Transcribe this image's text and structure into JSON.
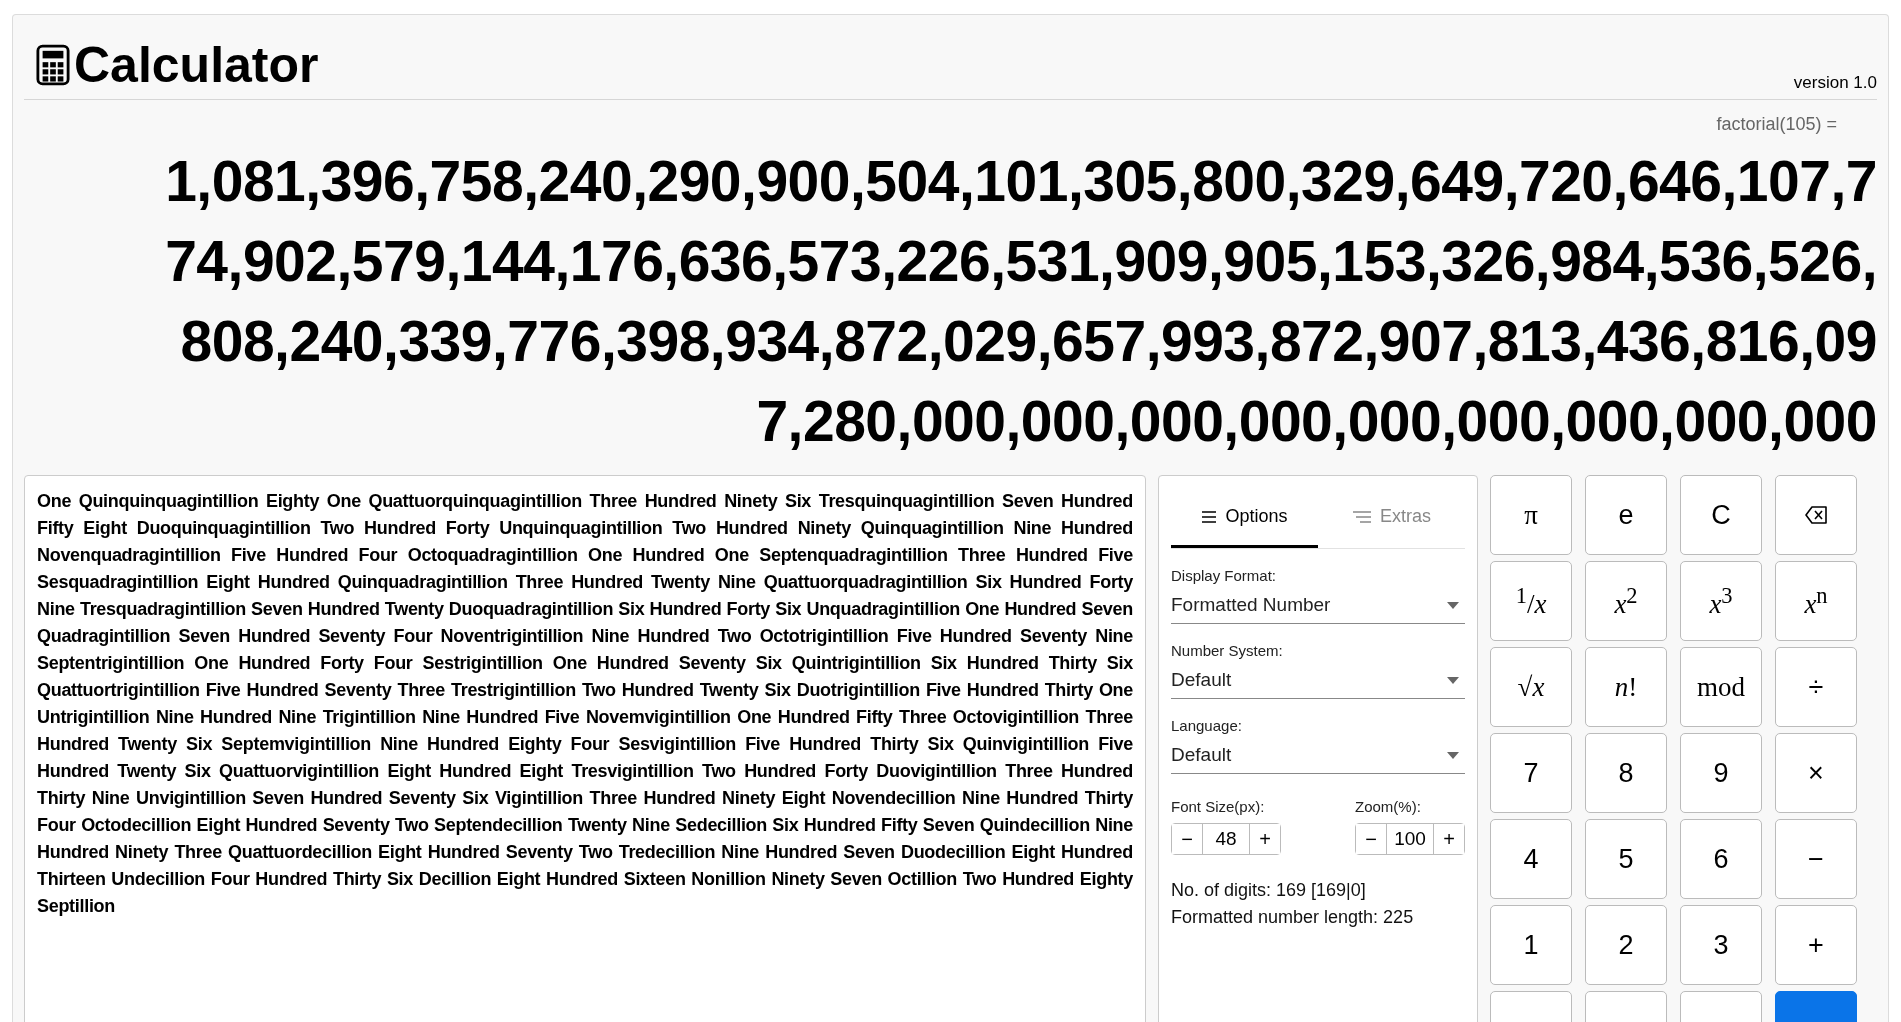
{
  "header": {
    "title": "Calculator",
    "version": "version 1.0"
  },
  "expression": "factorial(105) =",
  "result_lines": [
    "1,081,396,758,240,290,900,504,101,305,800,329,649,720,646,107,7",
    "74,902,579,144,176,636,573,226,531,909,905,153,326,984,536,526,",
    "808,240,339,776,398,934,872,029,657,993,872,907,813,436,816,09",
    "7,280,000,000,000,000,000,000,000,000,000"
  ],
  "words": "One Quinquinquagintillion Eighty One Quattuorquinquagintillion Three Hundred Ninety Six Tresquinquagintillion Seven Hundred Fifty Eight Duoquinquagintillion Two Hundred Forty Unquinquagintillion Two Hundred Ninety Quinquagintillion Nine Hundred Novenquadragintillion Five Hundred Four Octoquadragintillion One Hundred One Septenquadragintillion Three Hundred Five Sesquadragintillion Eight Hundred Quinquadragintillion Three Hundred Twenty Nine Quattuorquadragintillion Six Hundred Forty Nine Tresquadragintillion Seven Hundred Twenty Duoquadragintillion Six Hundred Forty Six Unquadragintillion One Hundred Seven Quadragintillion Seven Hundred Seventy Four Noventrigintillion Nine Hundred Two Octotrigintillion Five Hundred Seventy Nine Septentrigintillion One Hundred Forty Four Sestrigintillion One Hundred Seventy Six Quintrigintillion Six Hundred Thirty Six Quattuortrigintillion Five Hundred Seventy Three Trestrigintillion Two Hundred Twenty Six Duotrigintillion Five Hundred Thirty One Untrigintillion Nine Hundred Nine Trigintillion Nine Hundred Five Novemvigintillion One Hundred Fifty Three Octovigintillion Three Hundred Twenty Six Septemvigintillion Nine Hundred Eighty Four Sesvigintillion Five Hundred Thirty Six Quinvigintillion Five Hundred Twenty Six Quattuorvigintillion Eight Hundred Eight Tresvigintillion Two Hundred Forty Duovigintillion Three Hundred Thirty Nine Unvigintillion Seven Hundred Seventy Six Vigintillion Three Hundred Ninety Eight Novendecillion Nine Hundred Thirty Four Octodecillion Eight Hundred Seventy Two Septendecillion Twenty Nine Sedecillion Six Hundred Fifty Seven Quindecillion Nine Hundred Ninety Three Quattuordecillion Eight Hundred Seventy Two Tredecillion Nine Hundred Seven Duodecillion Eight Hundred Thirteen Undecillion Four Hundred Thirty Six Decillion Eight Hundred Sixteen Nonillion Ninety Seven Octillion Two Hundred Eighty Septillion",
  "options": {
    "tabs": [
      {
        "label": "Options",
        "selected": true
      },
      {
        "label": "Extras",
        "selected": false
      }
    ],
    "selects": [
      {
        "label": "Display Format:",
        "value": "Formatted Number"
      },
      {
        "label": "Number System:",
        "value": "Default"
      },
      {
        "label": "Language:",
        "value": "Default"
      }
    ],
    "steppers": [
      {
        "label": "Font Size(px):",
        "minus": "−",
        "value": "48",
        "plus": "+"
      },
      {
        "label": "Zoom(%):",
        "minus": "−",
        "value": "100",
        "plus": "+"
      }
    ],
    "stats": [
      "No. of digits: 169 [169|0]",
      "Formatted number length: 225"
    ]
  },
  "keys": [
    {
      "kind": "math",
      "label": "π"
    },
    {
      "kind": "plain",
      "label": "e"
    },
    {
      "kind": "plain",
      "label": "C"
    },
    {
      "kind": "backspace"
    },
    {
      "kind": "math",
      "label": "$^{1}$/*x*"
    },
    {
      "kind": "math",
      "label": "*x*$^{2}$"
    },
    {
      "kind": "math",
      "label": "*x*$^{3}$"
    },
    {
      "kind": "math",
      "label": "*x*$^{n}$"
    },
    {
      "kind": "math",
      "label": "√*x*"
    },
    {
      "kind": "math",
      "label": "*n*!"
    },
    {
      "kind": "math",
      "label": "mod"
    },
    {
      "kind": "plain",
      "label": "÷"
    },
    {
      "kind": "plain",
      "label": "7"
    },
    {
      "kind": "plain",
      "label": "8"
    },
    {
      "kind": "plain",
      "label": "9"
    },
    {
      "kind": "plain",
      "label": "×"
    },
    {
      "kind": "plain",
      "label": "4"
    },
    {
      "kind": "plain",
      "label": "5"
    },
    {
      "kind": "plain",
      "label": "6"
    },
    {
      "kind": "plain",
      "label": "−"
    },
    {
      "kind": "plain",
      "label": "1"
    },
    {
      "kind": "plain",
      "label": "2"
    },
    {
      "kind": "plain",
      "label": "3"
    },
    {
      "kind": "plain",
      "label": "+"
    },
    {
      "kind": "cut"
    },
    {
      "kind": "cut"
    },
    {
      "kind": "cut"
    },
    {
      "kind": "cut-accent"
    }
  ]
}
